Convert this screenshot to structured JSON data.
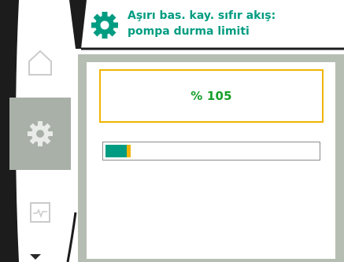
{
  "header": {
    "icon": "gear-icon",
    "title_line1": "Aşırı bas. kay. sıfır akış:",
    "title_line2": "pompa durma limiti"
  },
  "sidebar": {
    "items": [
      {
        "name": "home",
        "icon": "home-icon",
        "active": false
      },
      {
        "name": "settings",
        "icon": "gear-icon",
        "active": true
      },
      {
        "name": "diagnostics",
        "icon": "pulse-monitor-icon",
        "active": false
      }
    ],
    "scroll_icon": "chevron-down-icon"
  },
  "main": {
    "value_display": "% 105",
    "progress_fraction": 0.12
  },
  "colors": {
    "accent": "#009c82",
    "highlight": "#f2b400",
    "value_text": "#15a02a",
    "panel_border": "#b6bdb3",
    "sidebar_active": "#a9b0a8",
    "bezel": "#1c1c1c"
  }
}
